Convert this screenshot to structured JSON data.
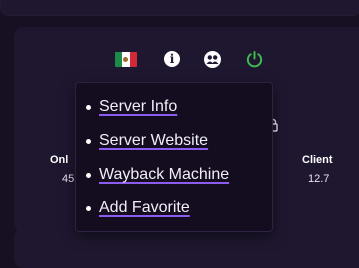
{
  "icons": {
    "flag": "mexico-flag-icon",
    "info": "info-icon",
    "info_glyph": "i",
    "users": "users-icon",
    "power": "power-icon",
    "lock": "lock-icon"
  },
  "colors": {
    "background": "#170f22",
    "card": "#1f1730",
    "menu_background": "#140d1f",
    "link_underline": "#8c5cf0",
    "power_green": "#3fbf4f"
  },
  "stats": {
    "online_label": "Onl",
    "online_value": "45",
    "client_label": "Client",
    "client_value": "12.7"
  },
  "menu": {
    "items": [
      {
        "label": "Server Info"
      },
      {
        "label": "Server Website"
      },
      {
        "label": "Wayback Machine"
      },
      {
        "label": "Add Favorite"
      }
    ]
  }
}
